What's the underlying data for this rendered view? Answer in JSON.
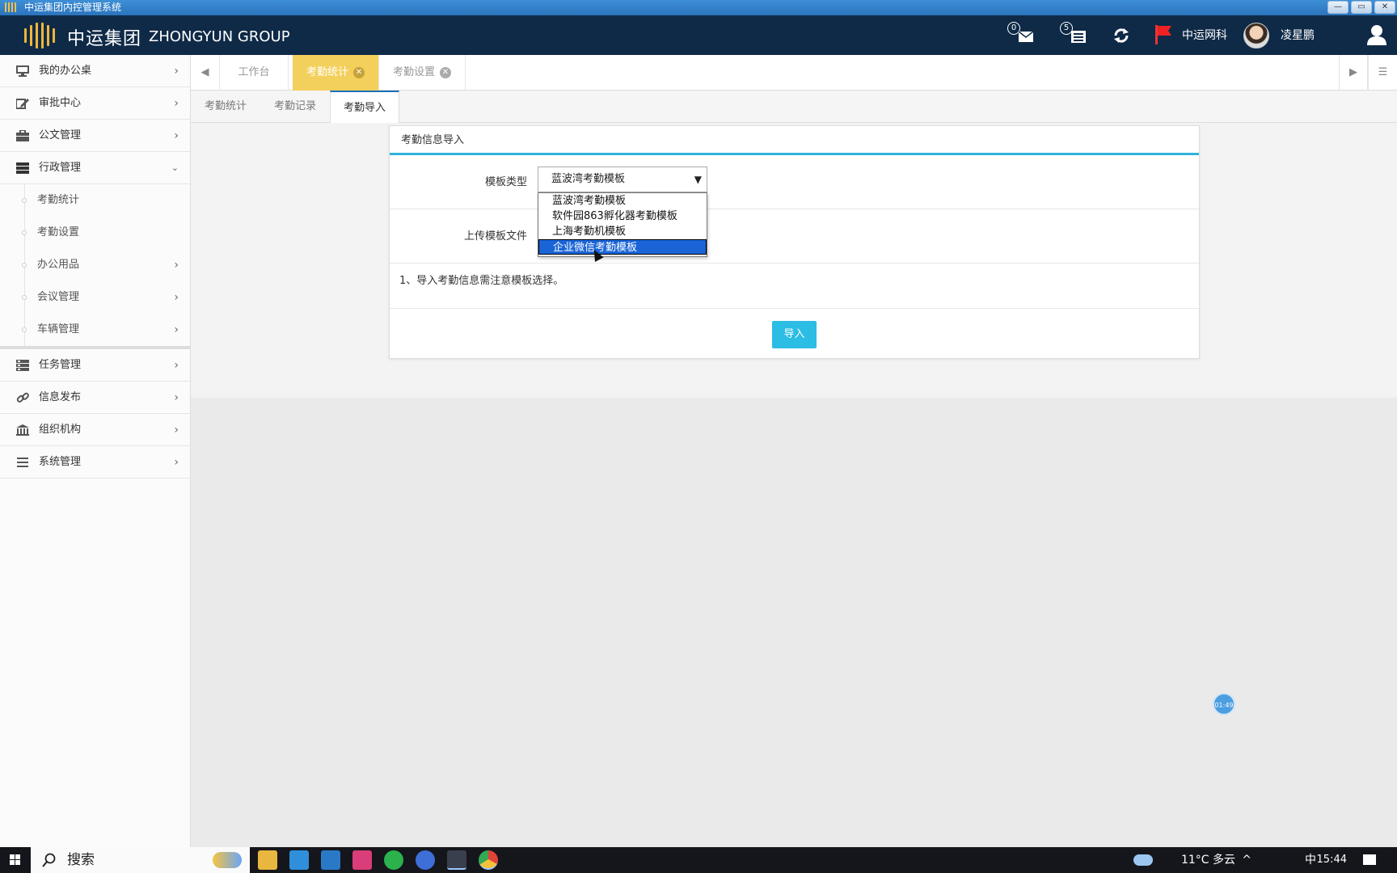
{
  "window": {
    "title": "中运集团内控管理系统",
    "controls": [
      "—",
      "▭",
      "✕"
    ]
  },
  "header": {
    "brand_cn": "中运集团",
    "brand_en": "ZHONGYUN GROUP",
    "msg_count": "0",
    "task_count": "5",
    "org": "中运网科",
    "user": "凌星鹏"
  },
  "sidebar": {
    "items": [
      {
        "label": "我的办公桌",
        "icon": "desktop-icon"
      },
      {
        "label": "审批中心",
        "icon": "edit-icon"
      },
      {
        "label": "公文管理",
        "icon": "briefcase-icon"
      },
      {
        "label": "行政管理",
        "icon": "server-icon",
        "expanded": true
      }
    ],
    "subitems": [
      "考勤统计",
      "考勤设置",
      "办公用品",
      "会议管理",
      "车辆管理"
    ],
    "items2": [
      {
        "label": "任务管理",
        "icon": "tasks-icon"
      },
      {
        "label": "信息发布",
        "icon": "link-icon"
      },
      {
        "label": "组织机构",
        "icon": "bank-icon"
      },
      {
        "label": "系统管理",
        "icon": "menu-icon"
      }
    ]
  },
  "tabs": [
    "工作台",
    "考勤统计",
    "考勤设置"
  ],
  "subtabs": [
    "考勤统计",
    "考勤记录",
    "考勤导入"
  ],
  "panel": {
    "title": "考勤信息导入",
    "template_label": "模板类型",
    "template_value": "蓝波湾考勤模板",
    "upload_label": "上传模板文件",
    "note": "1、导入考勤信息需注意模板选择。",
    "import_button": "导入"
  },
  "dropdown": {
    "options": [
      "蓝波湾考勤模板",
      "软件园863孵化器考勤模板",
      "上海考勤机模板",
      "企业微信考勤模板"
    ],
    "highlighted": 3
  },
  "timer": "01:49",
  "taskbar": {
    "search": "搜索",
    "weather": "11°C 多云",
    "ime": "中",
    "time": "15:44"
  },
  "colors": {
    "header": "#0f2a47",
    "active_tab": "#f3d05c",
    "accent": "#2bbde3",
    "select_highlight": "#1a64d8"
  }
}
